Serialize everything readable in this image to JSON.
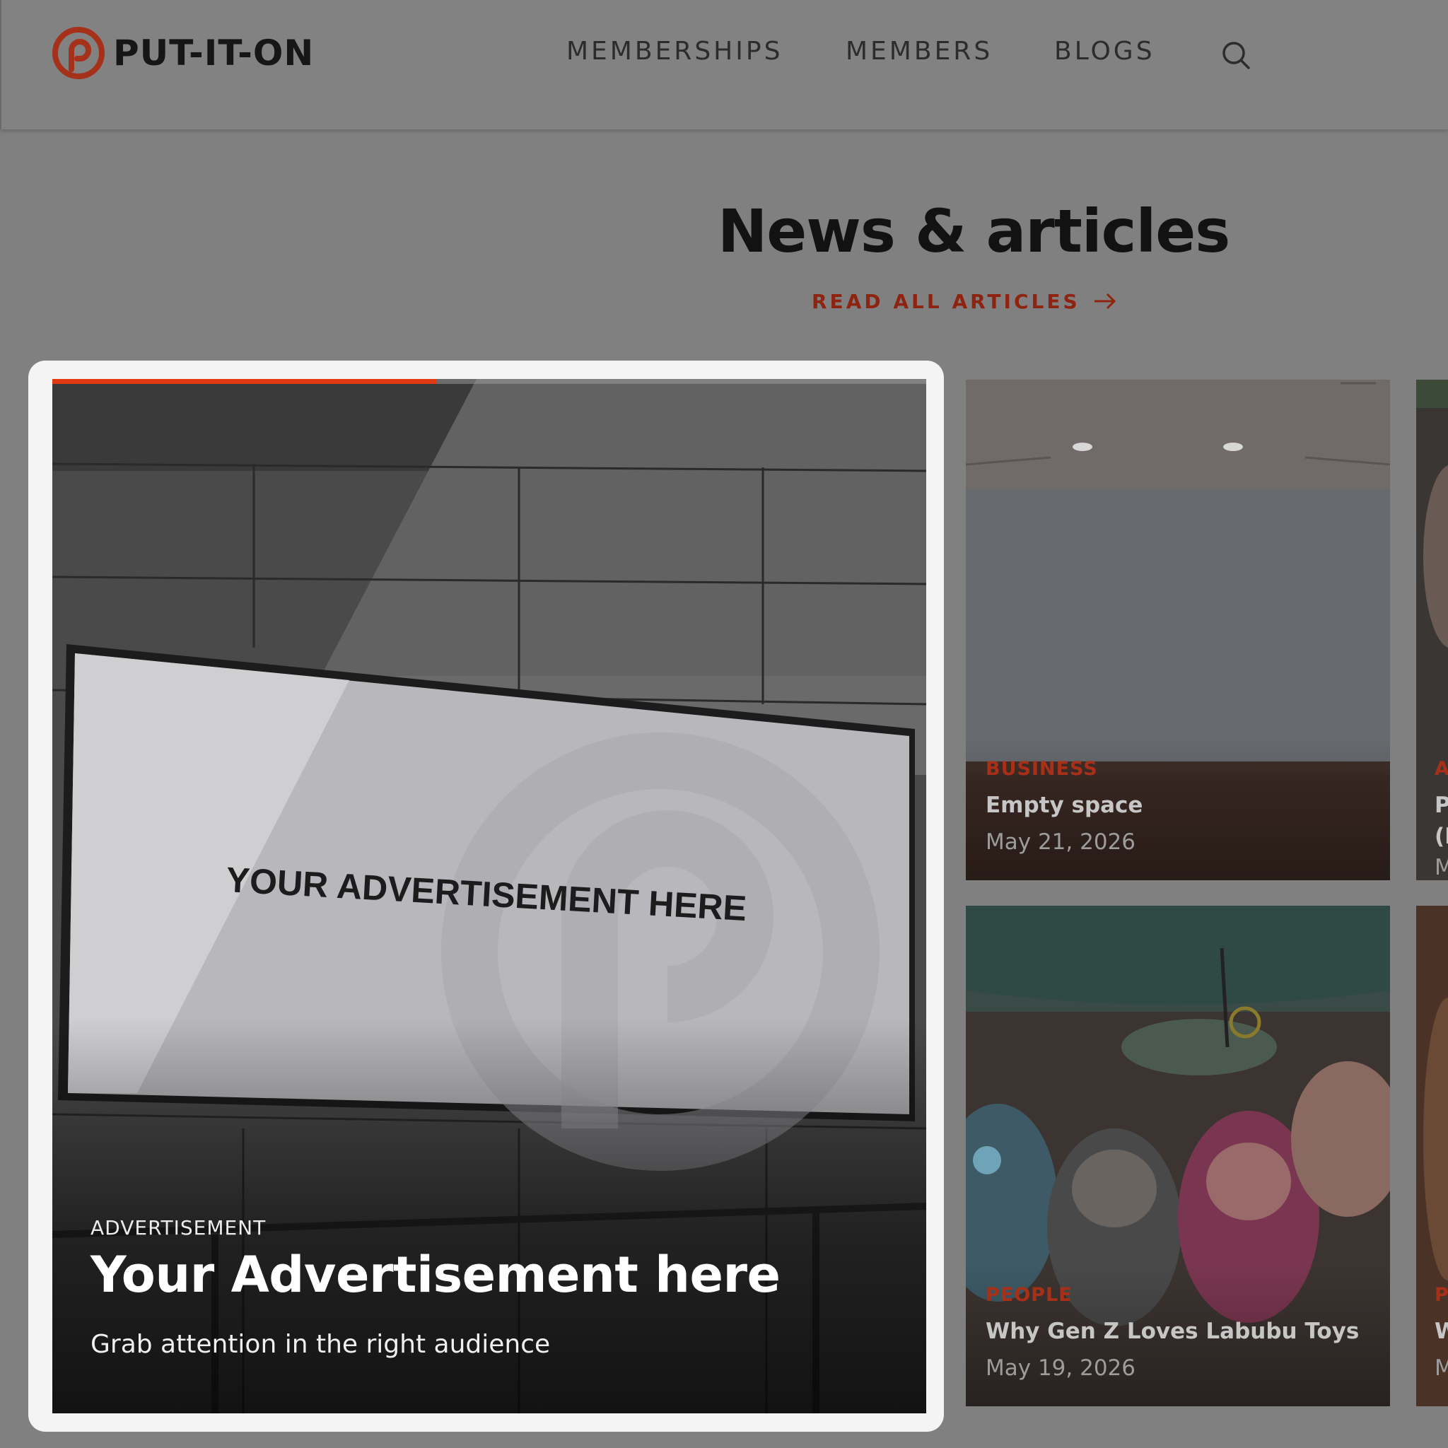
{
  "brand": {
    "name": "PUT-IT-ON",
    "accent_color": "#b8381c",
    "logo_icon": "put-it-on-logo-icon"
  },
  "nav": {
    "items": [
      {
        "label": "MEMBERSHIPS"
      },
      {
        "label": "MEMBERS"
      },
      {
        "label": "BLOGS"
      }
    ],
    "search_icon": "search-icon"
  },
  "section": {
    "title": "News & articles",
    "read_all_label": "READ ALL ARTICLES",
    "read_all_icon": "arrow-right-icon"
  },
  "featured": {
    "category": "ADVERTISEMENT",
    "title": "Your Advertisement here",
    "subtitle": "Grab attention in the right audience",
    "billboard_text": "YOUR ADVERTISEMENT HERE",
    "progress": 0.44,
    "progress_color": "#e23a12"
  },
  "articles": [
    {
      "category": "BUSINESS",
      "title": "Empty space",
      "date": "May 21, 2026"
    },
    {
      "category": "PEOPLE",
      "title": "Why Gen Z Loves Labubu Toys",
      "date": "May 19, 2026"
    }
  ],
  "partial_cards": [
    {
      "category": "A",
      "title_line1": "P",
      "title_line2": "(I",
      "date": "M"
    },
    {
      "category": "P",
      "title_line1": "W",
      "date": "M"
    }
  ]
}
